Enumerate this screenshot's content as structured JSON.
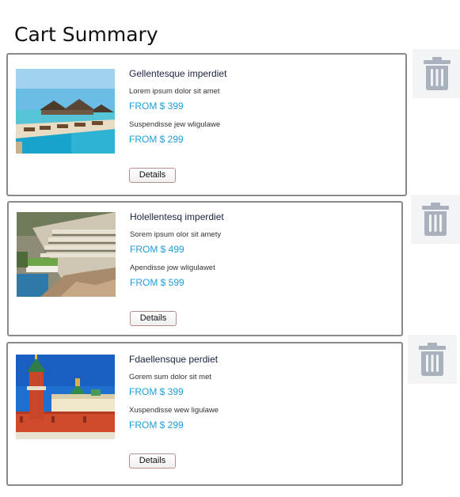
{
  "page": {
    "title": "Cart Summary"
  },
  "items": [
    {
      "title": "Gellentesque imperdiet",
      "image": "overwater-resort-pool-photo",
      "options": [
        {
          "desc": "Lorem ipsum dolor sit amet",
          "price": "FROM $ 399"
        },
        {
          "desc": "Suspendisse jew wligulawe",
          "price": "FROM $ 299"
        }
      ],
      "details_label": "Details",
      "delete_icon": "trash-icon"
    },
    {
      "title": "Holellentesq imperdiet",
      "image": "cliffside-terraced-hotel-photo",
      "options": [
        {
          "desc": "Sorem ipsum olor sit amety",
          "price": "FROM $ 499"
        },
        {
          "desc": "Apendisse jow wligulawet",
          "price": "FROM $ 599"
        }
      ],
      "details_label": "Details",
      "delete_icon": "trash-icon"
    },
    {
      "title": "Fdaellensque perdiet",
      "image": "kremlin-tower-photo",
      "options": [
        {
          "desc": "Gorem sum dolor sit met",
          "price": "FROM $ 399"
        },
        {
          "desc": "Xuspendisse wew ligulawe",
          "price": "FROM $ 299"
        }
      ],
      "details_label": "Details",
      "delete_icon": "trash-icon"
    }
  ],
  "colors": {
    "price": "#1f9ed8",
    "title": "#1a2440",
    "card_border": "#8a8a8a",
    "trash_icon": "#a9b2bc",
    "trash_bg": "#f3f4f5"
  }
}
